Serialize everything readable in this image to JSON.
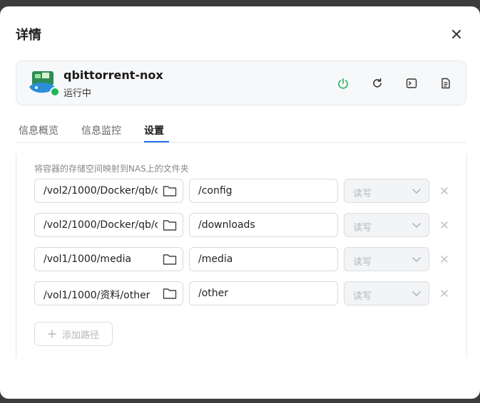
{
  "dialog": {
    "title": "详情"
  },
  "app": {
    "name": "qbittorrent-nox",
    "status": "运行中",
    "status_color": "#1fb45a"
  },
  "tabs": [
    {
      "label": "信息概览"
    },
    {
      "label": "信息监控"
    },
    {
      "label": "设置"
    }
  ],
  "active_tab": "设置",
  "settings": {
    "hint": "将容器的存储空间映射到NAS上的文件夹",
    "mappings": [
      {
        "host": "/vol2/1000/Docker/qb/c",
        "container": "/config",
        "permission": "读写"
      },
      {
        "host": "/vol2/1000/Docker/qb/c",
        "container": "/downloads",
        "permission": "读写"
      },
      {
        "host": "/vol1/1000/media",
        "container": "/media",
        "permission": "读写"
      },
      {
        "host": "/vol1/1000/资料/other",
        "container": "/other",
        "permission": "读写"
      }
    ],
    "add_label": "添加路径"
  },
  "icons": {
    "close": "close-icon",
    "power": "power-icon",
    "restart": "refresh-icon",
    "terminal": "terminal-icon",
    "logs": "document-icon",
    "folder": "folder-icon",
    "chevron": "chevron-down-icon",
    "remove": "close-icon",
    "add": "plus-icon"
  },
  "colors": {
    "accent": "#2a6df4",
    "power": "#1fb45a"
  }
}
